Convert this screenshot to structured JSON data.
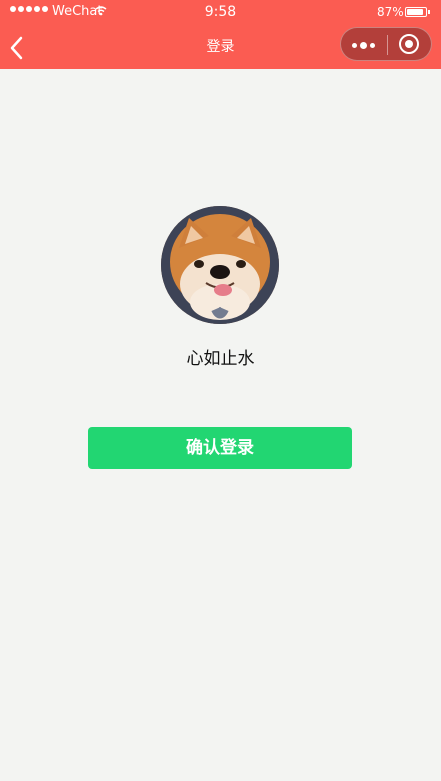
{
  "statusbar": {
    "carrier": "WeChat",
    "time": "9:58",
    "battery": "87%",
    "battery_level": 0.87
  },
  "navbar": {
    "title": "登录"
  },
  "profile": {
    "username": "心如止水"
  },
  "actions": {
    "login_label": "确认登录"
  },
  "colors": {
    "header": "#fb5c52",
    "button": "#22d672",
    "background": "#f3f4f2"
  }
}
